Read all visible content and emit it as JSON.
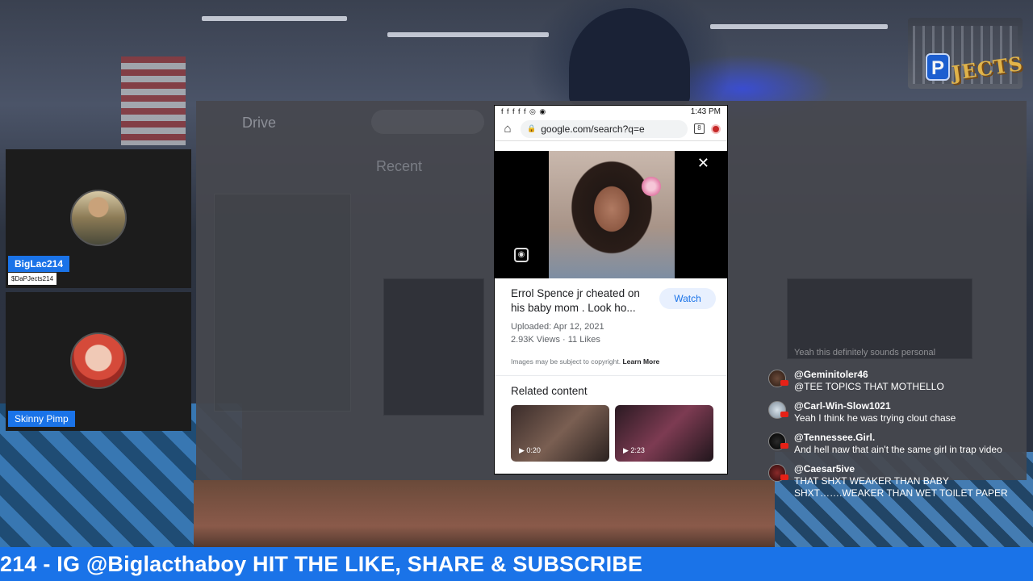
{
  "phone": {
    "status_time": "1:43 PM",
    "status_icons": "f f f f f ◎ ◉",
    "url": "google.com/search?q=e",
    "video_title": "Errol Spence jr cheated on his baby mom . Look ho...",
    "watch_label": "Watch",
    "uploaded": "Uploaded: Apr 12, 2021",
    "stats": "2.93K Views · 11 Likes",
    "copyright_text": "Images may be subject to copyright.",
    "learn_more": "Learn More",
    "related_heading": "Related content",
    "related": [
      {
        "duration": "▶ 0:20"
      },
      {
        "duration": "▶ 2:23"
      }
    ]
  },
  "participants": [
    {
      "name": "BigLac214",
      "sub": "$DaPJects214"
    },
    {
      "name": "Skinny Pimp"
    }
  ],
  "logo": {
    "letter": "P",
    "word": "JECTS"
  },
  "desktop": {
    "app": "Drive",
    "section": "Recent"
  },
  "chat": {
    "faded": "Yeah this definitely sounds personal",
    "messages": [
      {
        "user": "@Geminitoler46",
        "text": "@TEE TOPICS THAT MOTHELLO"
      },
      {
        "user": "@Carl-Win-Slow1021",
        "text": "Yeah I think he was trying clout chase"
      },
      {
        "user": "@Tennessee.Girl.",
        "text": "And hell naw that ain't the same girl in trap video"
      },
      {
        "user": "@Caesar5ive",
        "text": "THAT SHXT WEAKER THAN BABY SHXT…….WEAKER THAN WET TOILET PAPER"
      }
    ]
  },
  "ticker": "214 - IG @Biglacthaboy HIT THE LIKE, SHARE & SUBSCRIBE",
  "colors": {
    "accent": "#1a73e8",
    "youtube_red": "#e62117"
  }
}
